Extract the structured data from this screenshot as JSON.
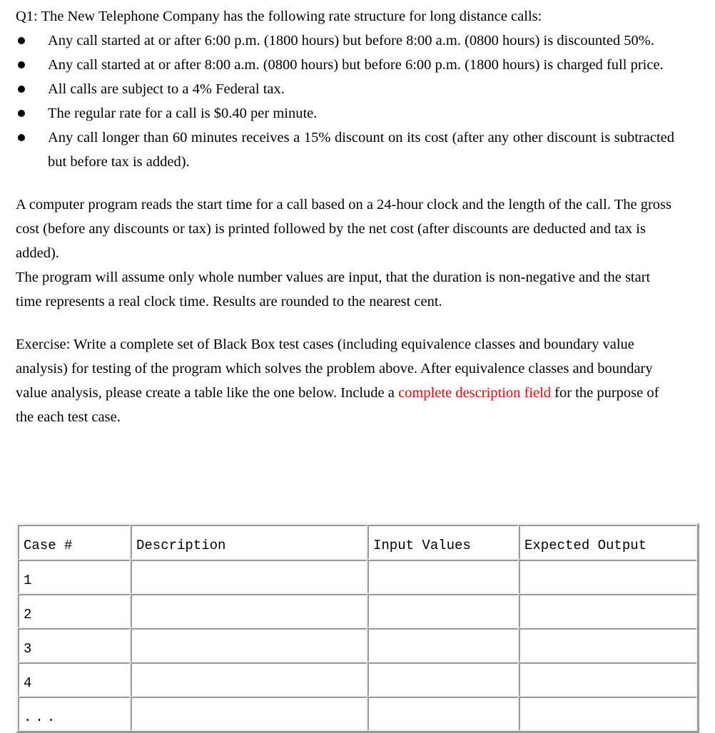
{
  "document": {
    "question_label": "Q1:",
    "intro": "Q1: The New Telephone Company has the following rate structure for long distance calls:",
    "bullets": [
      "Any call started at or after 6:00 p.m. (1800 hours) but before 8:00 a.m. (0800 hours) is discounted 50%.",
      "Any call started at or after 8:00 a.m. (0800 hours) but before 6:00 p.m. (1800 hours) is charged full price.",
      "All calls are subject to a 4% Federal tax.",
      "The regular rate for a call is $0.40 per minute.",
      "Any call longer than 60 minutes receives a 15% discount on its cost (after any other discount is subtracted but before tax is added)."
    ],
    "paragraph_1": "A computer program reads the start time for a call based on a 24-hour clock and the length of the call. The gross cost (before any discounts or tax) is printed followed by the net cost (after discounts are deducted and tax is added).",
    "paragraph_2": "The program will assume only whole number values are input, that the duration is non-negative and the start time represents a real clock time. Results are rounded to the nearest cent.",
    "exercise": {
      "part_1": "Exercise: Write a complete set of Black Box test cases (including equivalence classes and boundary value analysis) for testing of the program which solves the problem above. After equivalence classes and boundary value analysis, please create a table like the one below. Include a ",
      "highlight": "complete description field",
      "part_2": " for the purpose of the each test case.",
      "highlight_color": "#ff0000"
    }
  },
  "table": {
    "headers": [
      "Case #",
      "Description",
      "Input Values",
      "Expected Output"
    ],
    "rows": [
      [
        "1",
        "",
        "",
        ""
      ],
      [
        "2",
        "",
        "",
        ""
      ],
      [
        "3",
        "",
        "",
        ""
      ],
      [
        "4",
        "",
        "",
        ""
      ],
      [
        "...",
        "",
        "",
        ""
      ]
    ]
  }
}
